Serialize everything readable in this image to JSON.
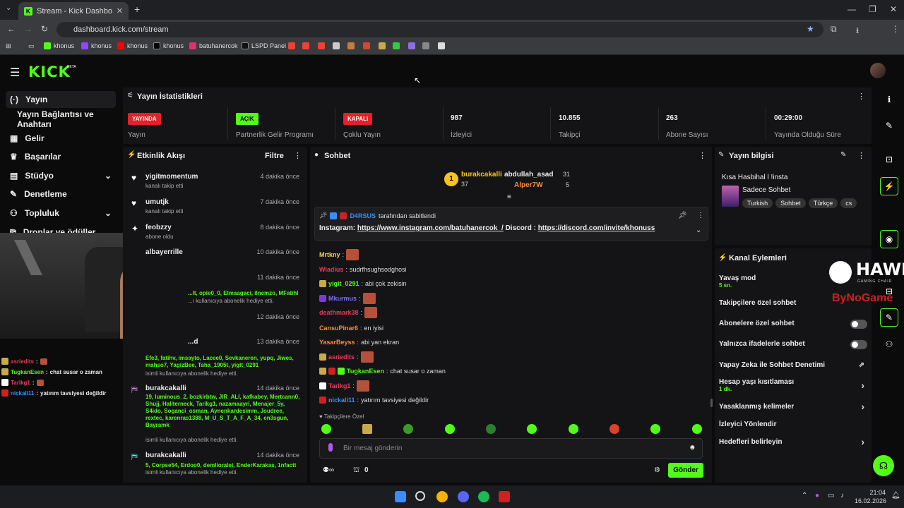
{
  "browser": {
    "tab_title": "Stream - Kick Dashboard",
    "url": "dashboard.kick.com/stream",
    "bookmarks": [
      "khonus",
      "khonus",
      "khonus",
      "khonus",
      "batuhanercok",
      "LSPD Panel"
    ]
  },
  "app": {
    "logo": "KICK",
    "beta": "BETA"
  },
  "sidebar": {
    "items": [
      {
        "label": "Yayın",
        "icon": "broadcast-icon"
      },
      {
        "label": "Yayın Bağlantısı ve Anahtarı"
      },
      {
        "label": "Gelir",
        "icon": "revenue-icon"
      },
      {
        "label": "Başarılar",
        "icon": "trophy-icon"
      },
      {
        "label": "Stüdyo",
        "icon": "studio-icon"
      },
      {
        "label": "Denetleme",
        "icon": "wrench-icon"
      },
      {
        "label": "Topluluk",
        "icon": "community-icon"
      },
      {
        "label": "Droplar ve ödüller",
        "icon": "gift-icon"
      }
    ]
  },
  "stats": {
    "title": "Yayın İstatistikleri",
    "items": [
      {
        "badge": "YAYINDA",
        "label": "Yayın"
      },
      {
        "badge": "AÇIK",
        "label": "Partnerlik Gelir Programı"
      },
      {
        "badge": "KAPALI",
        "label": "Çoklu Yayın"
      },
      {
        "value": "987",
        "label": "İzleyici"
      },
      {
        "value": "10.855",
        "label": "Takipçi"
      },
      {
        "value": "263",
        "label": "Abone Sayısı"
      },
      {
        "value": "00:29:00",
        "label": "Yayında Olduğu Süre"
      }
    ]
  },
  "activity": {
    "title": "Etkinlik Akışı",
    "filter": "Filtre",
    "events": [
      {
        "name": "yigitmomentum",
        "time": "4 dakika önce",
        "desc": "kanalı takip etti"
      },
      {
        "name": "umutjk",
        "time": "7 dakika önce",
        "desc": "kanalı takip etti"
      },
      {
        "name": "feobzzy",
        "time": "8 dakika önce",
        "desc": "abone oldu"
      },
      {
        "name": "albayerrille",
        "time": "10 dakika önce"
      },
      {
        "name": "",
        "time": "11 dakika önce",
        "gifts": "...lt, opie0_0, Elmaagaci, ilnemzo, MFatihl",
        "desc": "...ı kullanıcıya abonelik hediye etti."
      },
      {
        "name": "",
        "time": "12 dakika önce"
      },
      {
        "name": "...d",
        "time": "13 dakika önce",
        "gifts": "Efe3, fatihv, imsayto, Lacee0, Sevkaneren, yupq, Jiwes, mahso7, YagizBee, Taha_1905t, yigit_0291",
        "desc": "isimli kullanıcıya abonelik hediye etti."
      },
      {
        "name": "burakcakalli",
        "time": "14 dakika önce",
        "gifts": "19, luminous_2, bozkirbtw, JIR_ALI, kafkabey, Mertcann0, Shujj, Haliterneck, Tarikg1, nazamaayri, Menajer_5y, S4ido, Soganci_osman, Aynenkardesimm, Joudree, rextec, karenras1388, M_U_S_T_A_F_A_34, en3sgun, Bayramk",
        "desc": "isimli kullanıcıya abonelik hediye etti."
      },
      {
        "name": "burakcakalli",
        "time": "14 dakika önce",
        "gifts": "5, Corpse54, Erdoo0, demlioralet, EnderKarakas, 1nfactt",
        "desc": "isimli kullanıcıya abonelik hediye etti."
      }
    ]
  },
  "chat": {
    "title": "Sohbet",
    "top": {
      "first": {
        "name": "burakcakalli",
        "count": "37",
        "rank": "1"
      },
      "second": {
        "name": "abdullah_asad",
        "count": "31"
      },
      "third": {
        "name": "Alper7W",
        "count": "5"
      }
    },
    "pinned": {
      "by": "D4RSUS",
      "by_text": "tarafından sabitlendi",
      "label1": "Instagram:",
      "link1": "https://www.instagram.com/batuhanercok_/",
      "label2": "Discord :",
      "link2": "https://discord.com/invite/khonuss"
    },
    "messages": [
      {
        "user": "Mrtkny",
        "text": "",
        "color": "#f0d060"
      },
      {
        "user": "Wiadius",
        "text": "sudrfhsughsodghosi",
        "color": "#e83a5a"
      },
      {
        "user": "yigit_0291",
        "text": "abi çok zekisin",
        "color": "#53fc18"
      },
      {
        "user": "Mkurmus",
        "text": "",
        "color": "#7b6dff"
      },
      {
        "user": "deathmark38",
        "text": "",
        "color": "#e83a5a"
      },
      {
        "user": "CansuPinar6",
        "text": "en iyisi",
        "color": "#ff8a3c"
      },
      {
        "user": "YasarBeyss",
        "text": "abi yan ekran",
        "color": "#ff8a3c"
      },
      {
        "user": "asriedits",
        "text": "",
        "color": "#e83a5a"
      },
      {
        "user": "TugkanEsen",
        "text": "chat susar o zaman",
        "color": "#53fc18"
      },
      {
        "user": "Tarikg1",
        "text": "",
        "color": "#e83a5a"
      },
      {
        "user": "nickali11",
        "text": "yatırım tavsiyesi değildir",
        "color": "#3a8cff"
      }
    ],
    "followers_only": "Takipçilere Özel",
    "input_placeholder": "Bir mesaj gönderin",
    "points": "0",
    "send": "Gönder"
  },
  "stream_info": {
    "title": "Yayın bilgisi",
    "stream_title": "Kısa Hasbihal l !insta",
    "category": "Sadece Sohbet",
    "tags": [
      "Turkish",
      "Sohbet",
      "Türkçe",
      "cs"
    ]
  },
  "channel_actions": {
    "title": "Kanal Eylemleri",
    "slow_mode": "Yavaş mod",
    "slow_mode_value": "5 sn.",
    "followers_chat": "Takipçilere özel sohbet",
    "subscribers_chat": "Abonelere özel sohbet",
    "emotes_only": "Yalnızca ifadelerle sohbet",
    "ai_moderation": "Yapay Zeka ile Sohbet Denetimi",
    "account_age": "Hesap yaşı kısıtlaması",
    "account_age_value": "1 dk.",
    "banned_words": "Yasaklanmış kelimeler",
    "raid": "İzleyici Yönlendir",
    "goals": "Hedefleri belirleyin"
  },
  "overlay": {
    "sponsor": "HAWK",
    "sponsor_sub": "GAMING CHAIR",
    "sponsor2": "ByNoGame",
    "webcam_chat": [
      {
        "user": "asriedits",
        "text": ""
      },
      {
        "user": "TugkanEsen",
        "text": "chat susar o zaman"
      },
      {
        "user": "Tarikg1",
        "text": ""
      },
      {
        "user": "nickali11",
        "text": "yatırım tavsiyesi değildir"
      }
    ]
  },
  "taskbar": {
    "time": "21:04",
    "date": "16.02.2026"
  }
}
